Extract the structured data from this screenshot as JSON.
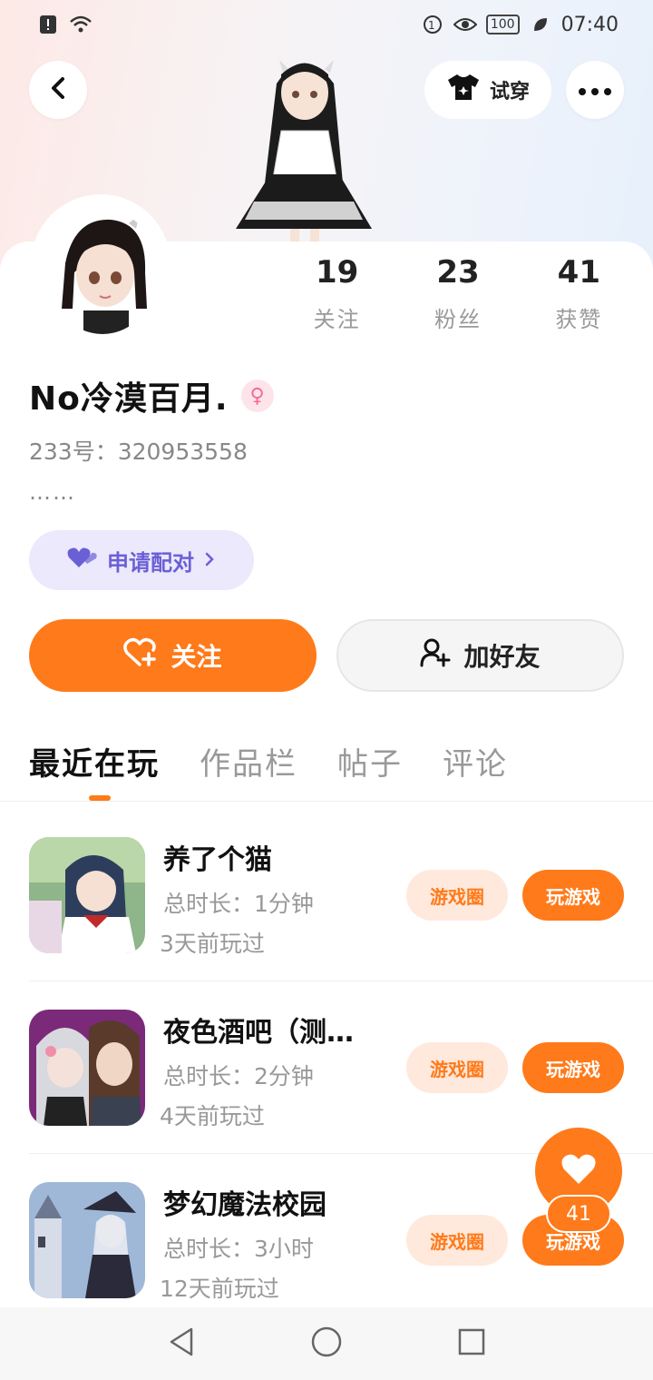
{
  "status_bar": {
    "time": "07:40",
    "battery": "100"
  },
  "header": {
    "tryon_label": "试穿"
  },
  "stats": [
    {
      "value": "19",
      "label": "关注"
    },
    {
      "value": "23",
      "label": "粉丝"
    },
    {
      "value": "41",
      "label": "获赞"
    }
  ],
  "profile": {
    "name": "No冷漠百月.",
    "uid": "233号：320953558",
    "bio": "……",
    "gender_symbol": "♀",
    "pair_label": "申请配对",
    "follow_label": "关注",
    "add_friend_label": "加好友"
  },
  "tabs": [
    "最近在玩",
    "作品栏",
    "帖子",
    "评论"
  ],
  "games": [
    {
      "title": "养了个猫",
      "duration": "总时长：1分钟",
      "last_played": "3天前玩过",
      "circle_label": "游戏圈",
      "play_label": "玩游戏"
    },
    {
      "title": "夜色酒吧（测…",
      "duration": "总时长：2分钟",
      "last_played": "4天前玩过",
      "circle_label": "游戏圈",
      "play_label": "玩游戏"
    },
    {
      "title": "梦幻魔法校园",
      "duration": "总时长：3小时",
      "last_played": "12天前玩过",
      "circle_label": "游戏圈",
      "play_label": "玩游戏"
    }
  ],
  "like_fab": {
    "count": "41"
  },
  "colors": {
    "accent": "#ff7a1a",
    "pair_purple": "#6b5fd6",
    "gender_pink": "#f46b92"
  }
}
